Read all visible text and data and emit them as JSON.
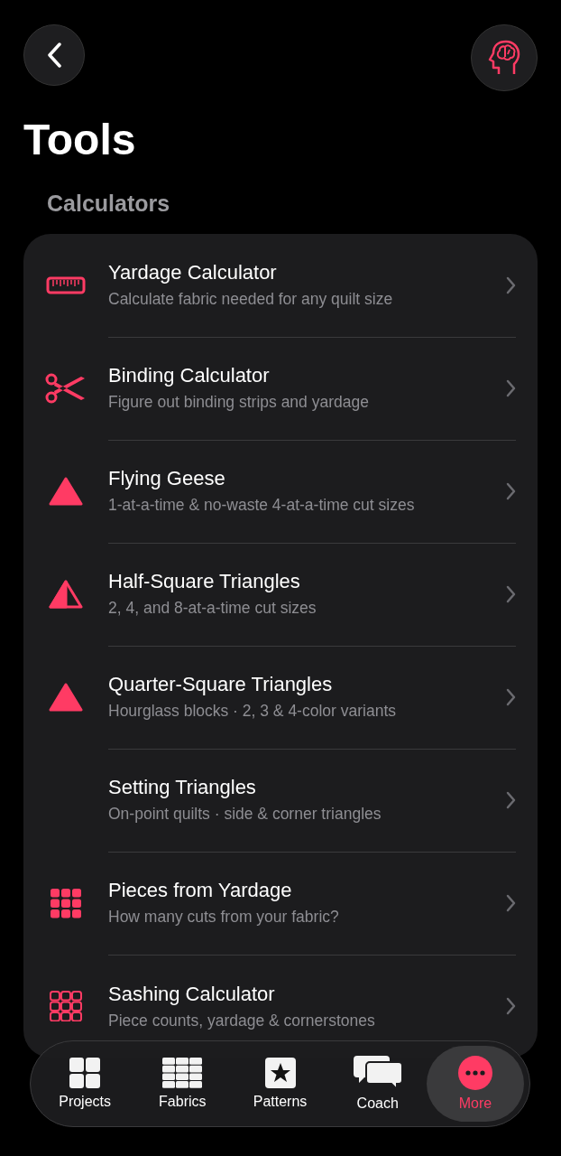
{
  "title": "Tools",
  "section": "Calculators",
  "items": [
    {
      "kind": "ruler",
      "title": "Yardage Calculator",
      "subtitle": "Calculate fabric needed for any quilt size"
    },
    {
      "kind": "scissors",
      "title": "Binding Calculator",
      "subtitle": "Figure out binding strips and yardage"
    },
    {
      "kind": "triangle",
      "title": "Flying Geese",
      "subtitle": "1-at-a-time & no-waste 4-at-a-time cut sizes"
    },
    {
      "kind": "half-triangle",
      "title": "Half-Square Triangles",
      "subtitle": "2, 4, and 8-at-a-time cut sizes"
    },
    {
      "kind": "triangle",
      "title": "Quarter-Square Triangles",
      "subtitle": "Hourglass blocks · 2, 3 & 4-color variants"
    },
    {
      "kind": "none",
      "title": "Setting Triangles",
      "subtitle": "On-point quilts · side & corner triangles"
    },
    {
      "kind": "grid",
      "title": "Pieces from Yardage",
      "subtitle": "How many cuts from your fabric?"
    },
    {
      "kind": "grid-outline",
      "title": "Sashing Calculator",
      "subtitle": "Piece counts, yardage & cornerstones"
    }
  ],
  "tabs": [
    {
      "kind": "squares",
      "label": "Projects",
      "selected": false
    },
    {
      "kind": "table",
      "label": "Fabrics",
      "selected": false
    },
    {
      "kind": "star",
      "label": "Patterns",
      "selected": false
    },
    {
      "kind": "chat",
      "label": "Coach",
      "selected": false
    },
    {
      "kind": "more",
      "label": "More",
      "selected": true
    }
  ]
}
